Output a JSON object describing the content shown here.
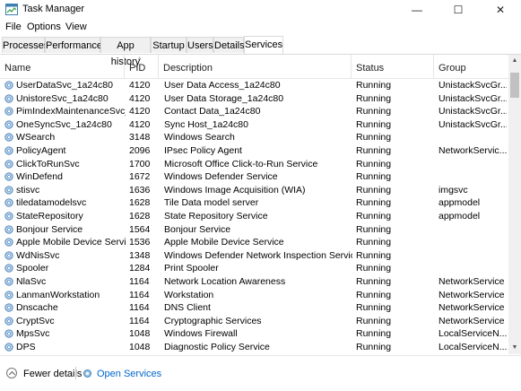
{
  "window": {
    "title": "Task Manager",
    "minimize": "—",
    "maximize": "☐",
    "close": "✕"
  },
  "menu": [
    "File",
    "Options",
    "View"
  ],
  "tabs": [
    "Processes",
    "Performance",
    "App history",
    "Startup",
    "Users",
    "Details",
    "Services"
  ],
  "active_tab": "Services",
  "columns": [
    "Name",
    "PID",
    "Description",
    "Status",
    "Group"
  ],
  "rows": [
    [
      "UserDataSvc_1a24c80",
      "4120",
      "User Data Access_1a24c80",
      "Running",
      "UnistackSvcGr..."
    ],
    [
      "UnistoreSvc_1a24c80",
      "4120",
      "User Data Storage_1a24c80",
      "Running",
      "UnistackSvcGr..."
    ],
    [
      "PimIndexMaintenanceSvc_...",
      "4120",
      "Contact Data_1a24c80",
      "Running",
      "UnistackSvcGr..."
    ],
    [
      "OneSyncSvc_1a24c80",
      "4120",
      "Sync Host_1a24c80",
      "Running",
      "UnistackSvcGr..."
    ],
    [
      "WSearch",
      "3148",
      "Windows Search",
      "Running",
      ""
    ],
    [
      "PolicyAgent",
      "2096",
      "IPsec Policy Agent",
      "Running",
      "NetworkServic..."
    ],
    [
      "ClickToRunSvc",
      "1700",
      "Microsoft Office Click-to-Run Service",
      "Running",
      ""
    ],
    [
      "WinDefend",
      "1672",
      "Windows Defender Service",
      "Running",
      ""
    ],
    [
      "stisvc",
      "1636",
      "Windows Image Acquisition (WIA)",
      "Running",
      "imgsvc"
    ],
    [
      "tiledatamodelsvc",
      "1628",
      "Tile Data model server",
      "Running",
      "appmodel"
    ],
    [
      "StateRepository",
      "1628",
      "State Repository Service",
      "Running",
      "appmodel"
    ],
    [
      "Bonjour Service",
      "1564",
      "Bonjour Service",
      "Running",
      ""
    ],
    [
      "Apple Mobile Device Service",
      "1536",
      "Apple Mobile Device Service",
      "Running",
      ""
    ],
    [
      "WdNisSvc",
      "1348",
      "Windows Defender Network Inspection Service",
      "Running",
      ""
    ],
    [
      "Spooler",
      "1284",
      "Print Spooler",
      "Running",
      ""
    ],
    [
      "NlaSvc",
      "1164",
      "Network Location Awareness",
      "Running",
      "NetworkService"
    ],
    [
      "LanmanWorkstation",
      "1164",
      "Workstation",
      "Running",
      "NetworkService"
    ],
    [
      "Dnscache",
      "1164",
      "DNS Client",
      "Running",
      "NetworkService"
    ],
    [
      "CryptSvc",
      "1164",
      "Cryptographic Services",
      "Running",
      "NetworkService"
    ],
    [
      "MpsSvc",
      "1048",
      "Windows Firewall",
      "Running",
      "LocalServiceN..."
    ],
    [
      "DPS",
      "1048",
      "Diagnostic Policy Service",
      "Running",
      "LocalServiceN..."
    ]
  ],
  "footer": {
    "fewer_details": "Fewer details",
    "open_services": "Open Services"
  },
  "icons": {
    "service": "gear-icon",
    "app": "task-manager-icon"
  },
  "colors": {
    "link": "#0066cc",
    "accent": "#3c7fb1"
  }
}
